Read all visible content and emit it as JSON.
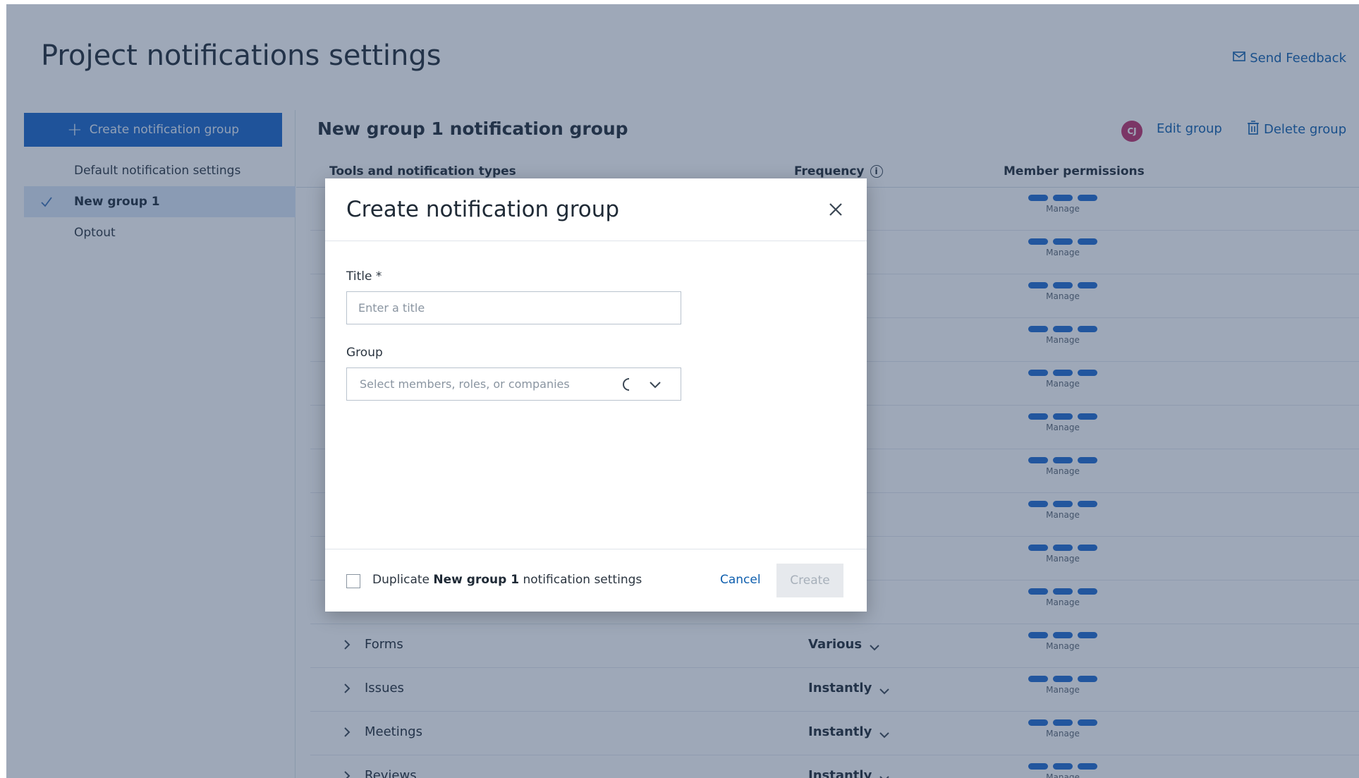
{
  "page": {
    "title": "Project notifications settings",
    "feedback_label": "Send Feedback"
  },
  "sidebar": {
    "create_button_label": "Create notification group",
    "items": [
      {
        "label": "Default notification settings",
        "active": false
      },
      {
        "label": "New group 1",
        "active": true
      },
      {
        "label": "Optout",
        "active": false
      }
    ]
  },
  "main": {
    "group_title": "New group 1 notification group",
    "avatar_initials": "CJ",
    "edit_label": "Edit group",
    "delete_label": "Delete group",
    "columns": {
      "tools": "Tools and notification types",
      "frequency": "Frequency",
      "permissions": "Member permissions"
    },
    "manage_label": "Manage",
    "rows": [
      {
        "name": "",
        "frequency": ""
      },
      {
        "name": "",
        "frequency": ""
      },
      {
        "name": "",
        "frequency": ""
      },
      {
        "name": "",
        "frequency": ""
      },
      {
        "name": "",
        "frequency": ""
      },
      {
        "name": "",
        "frequency": ""
      },
      {
        "name": "",
        "frequency": ""
      },
      {
        "name": "",
        "frequency": ""
      },
      {
        "name": "",
        "frequency": ""
      },
      {
        "name": "",
        "frequency": ""
      },
      {
        "name": "Forms",
        "frequency": "Various"
      },
      {
        "name": "Issues",
        "frequency": "Instantly"
      },
      {
        "name": "Meetings",
        "frequency": "Instantly"
      },
      {
        "name": "Reviews",
        "frequency": "Instantly"
      }
    ]
  },
  "modal": {
    "title": "Create notification group",
    "title_field_label": "Title",
    "required_mark": "*",
    "title_placeholder": "Enter a title",
    "group_field_label": "Group",
    "group_placeholder": "Select members, roles, or companies",
    "duplicate_prefix": "Duplicate ",
    "duplicate_group": "New group 1",
    "duplicate_suffix": " notification settings",
    "cancel_label": "Cancel",
    "create_label": "Create"
  },
  "colors": {
    "accent": "#1865c9",
    "link": "#0f5fae",
    "overlay": "#283e62",
    "avatar": "#c0306a"
  },
  "icons": [
    "mail-icon",
    "plus-icon",
    "check-icon",
    "trash-icon",
    "info-icon",
    "chevron-right-icon",
    "chevron-down-icon",
    "close-icon",
    "spinner-icon"
  ]
}
